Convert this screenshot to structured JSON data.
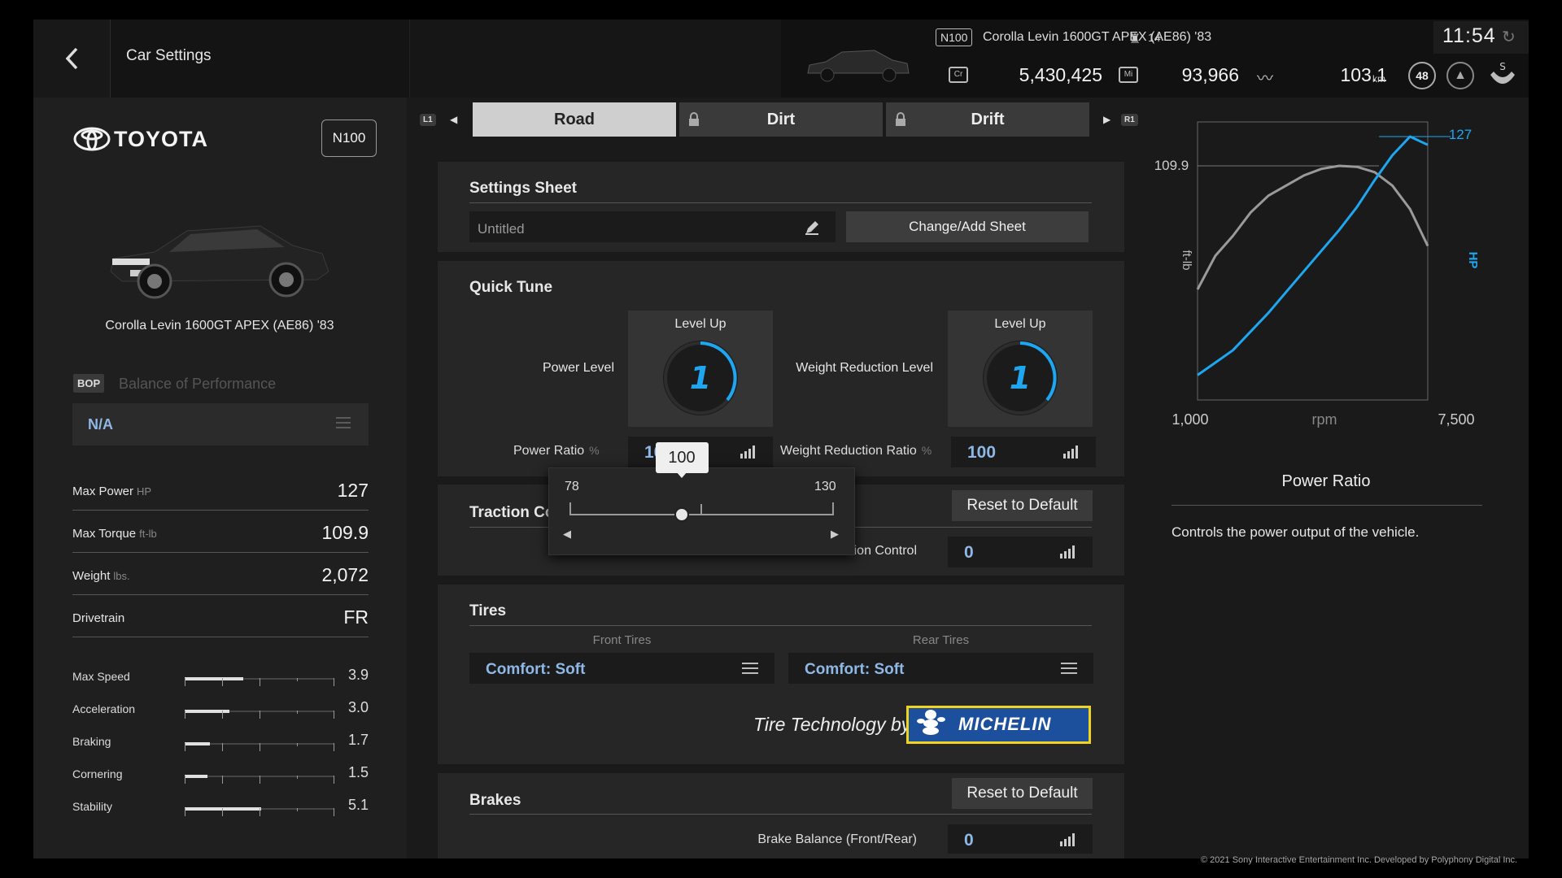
{
  "header": {
    "title": "Car Settings",
    "car_class": "N100",
    "car_name": "Corolla Levin 1600GT APEX (AE86) '83",
    "stat_small": "14",
    "clock": "11:54",
    "credits": "5,430,425",
    "mileage": "93,966",
    "distance": "103.1",
    "distance_unit": "km",
    "level": "48"
  },
  "sidebar": {
    "maker": "TOYOTA",
    "class_badge": "N100",
    "car_name": "Corolla Levin 1600GT APEX (AE86) '83",
    "bop_badge": "BOP",
    "bop_label": "Balance of Performance",
    "bop_value": "N/A",
    "specs": [
      {
        "label": "Max Power",
        "unit": "HP",
        "value": "127"
      },
      {
        "label": "Max Torque",
        "unit": "ft-lb",
        "value": "109.9"
      },
      {
        "label": "Weight",
        "unit": "lbs.",
        "value": "2,072"
      },
      {
        "label": "Drivetrain",
        "unit": "",
        "value": "FR"
      }
    ],
    "performance": [
      {
        "label": "Max Speed",
        "value": "3.9",
        "level": 0.39
      },
      {
        "label": "Acceleration",
        "value": "3.0",
        "level": 0.3
      },
      {
        "label": "Braking",
        "value": "1.7",
        "level": 0.17
      },
      {
        "label": "Cornering",
        "value": "1.5",
        "level": 0.15
      },
      {
        "label": "Stability",
        "value": "5.1",
        "level": 0.51
      }
    ]
  },
  "tabs": {
    "left_shoulder": "L1",
    "right_shoulder": "R1",
    "items": [
      {
        "label": "Road",
        "active": true,
        "locked": false
      },
      {
        "label": "Dirt",
        "active": false,
        "locked": true
      },
      {
        "label": "Drift",
        "active": false,
        "locked": true
      }
    ]
  },
  "settings_sheet": {
    "title": "Settings Sheet",
    "sheet_name": "Untitled",
    "change_button": "Change/Add Sheet"
  },
  "quick_tune": {
    "title": "Quick Tune",
    "power_level_label": "Power Level",
    "power_level_caption": "Level Up",
    "power_level_value": "1",
    "weight_level_label": "Weight Reduction Level",
    "weight_level_caption": "Level Up",
    "weight_level_value": "1",
    "power_ratio_label": "Power Ratio",
    "power_ratio_unit": "%",
    "power_ratio_value": "100",
    "weight_ratio_label": "Weight Reduction Ratio",
    "weight_ratio_unit": "%",
    "weight_ratio_value": "100"
  },
  "slider_popup": {
    "min": "78",
    "max": "130",
    "value": "100",
    "value_num": 100,
    "min_num": 78,
    "max_num": 130
  },
  "traction": {
    "title": "Traction Control",
    "reset_button": "Reset to Default",
    "label": "Traction Control",
    "value": "0"
  },
  "tires": {
    "title": "Tires",
    "front_label": "Front Tires",
    "rear_label": "Rear Tires",
    "front_value": "Comfort: Soft",
    "rear_value": "Comfort: Soft",
    "tech_label": "Tire Technology by",
    "brand": "MICHELIN"
  },
  "brakes": {
    "title": "Brakes",
    "reset_button": "Reset to Default",
    "balance_label": "Brake Balance (Front/Rear)",
    "balance_value": "0"
  },
  "chart_data": {
    "type": "line",
    "title": "",
    "xlabel": "rpm",
    "ylabel_left": "ft-lb",
    "ylabel_right": "HP",
    "x_tick_labels": [
      "1,000",
      "7,500"
    ],
    "xlim": [
      1000,
      7500
    ],
    "torque_peak_label": "109.9",
    "power_peak_label": "127",
    "series": [
      {
        "name": "ft-lb",
        "color": "#9a9a9a",
        "x": [
          1000,
          1500,
          2000,
          2500,
          3000,
          3500,
          4000,
          4500,
          5000,
          5500,
          6000,
          6500,
          7000,
          7500
        ],
        "y": [
          73,
          83,
          89,
          96,
          101,
          104,
          107,
          109,
          109.9,
          109.6,
          108,
          104,
          97,
          86
        ]
      },
      {
        "name": "HP",
        "color": "#1ea7f0",
        "x": [
          1000,
          1500,
          2000,
          2500,
          3000,
          3500,
          4000,
          4500,
          5000,
          5500,
          6000,
          6500,
          7000,
          7500
        ],
        "y": [
          12,
          18,
          24,
          33,
          42,
          52,
          62,
          72,
          82,
          93,
          106,
          118,
          127,
          123
        ]
      }
    ]
  },
  "info_panel": {
    "title": "Power Ratio",
    "description": "Controls the power output of the vehicle."
  },
  "footer": {
    "copyright": "© 2021 Sony Interactive Entertainment Inc. Developed by Polyphony Digital Inc."
  },
  "colors": {
    "accent_blue": "#1ea7f0",
    "value_blue": "#8fb8e6",
    "michelin_blue": "#1c4f9c",
    "michelin_yellow": "#f2d31b"
  }
}
